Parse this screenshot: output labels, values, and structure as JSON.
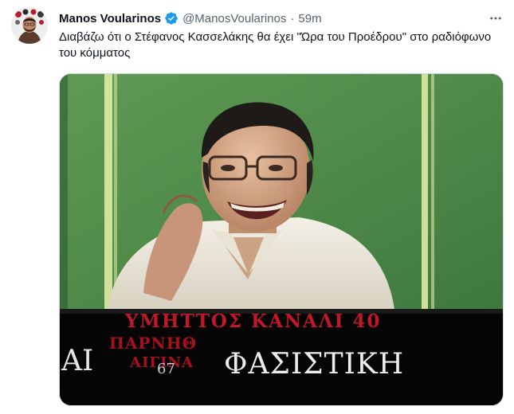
{
  "tweet": {
    "author_name": "Manos Voularinos",
    "author_handle": "@ManosVoularinos",
    "separator": "·",
    "timestamp": "59m",
    "body": "Διαβάζω ότι ο Στέφανος Κασσελάκης θα έχει \"Ώρα του Προέδρου\" στο ραδιόφωνο του κόμματος"
  },
  "media": {
    "caption_line1": "ΥΜΗΤΤΟΣ ΚΑΝΑΛΙ 40",
    "caption_line2": "ΠΑΡΝΗΘ",
    "caption_line3": "ΑΙΓΙΝΑ",
    "caption_left": "ΑΙ",
    "caption_mid": "67",
    "caption_main": "ΦΑΣΙΣΤΙΚΗ"
  },
  "colors": {
    "verified": "#1d9bf0",
    "secondary_text": "#536471",
    "caption_red": "#c0182a"
  }
}
